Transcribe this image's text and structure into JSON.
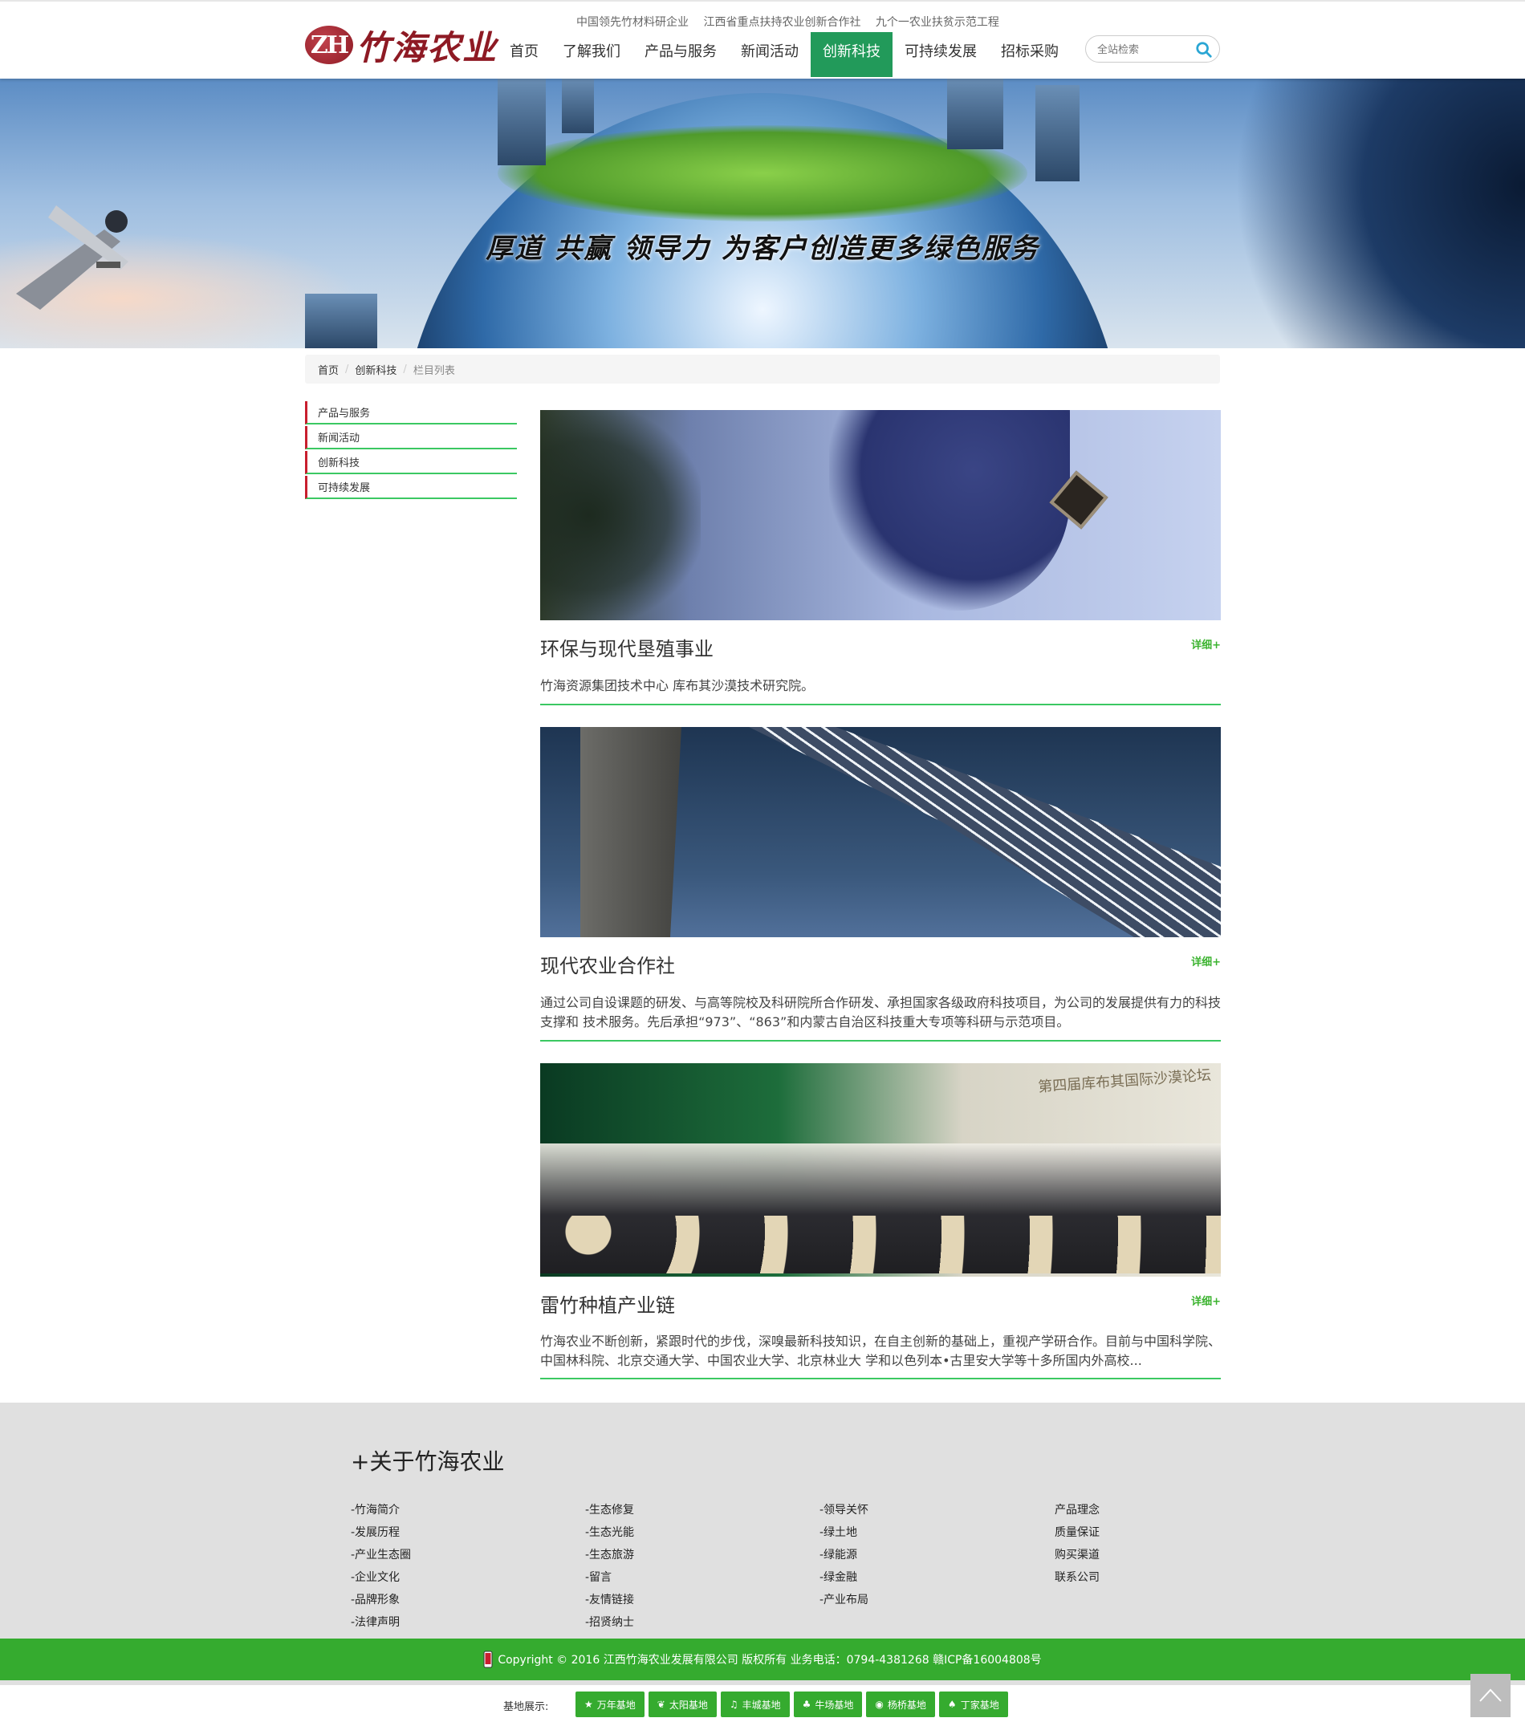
{
  "header": {
    "logo_mark": "ZH",
    "logo_text": "竹海农业",
    "slogans": [
      "中国领先竹材料研企业",
      "江西省重点扶持农业创新合作社",
      "九个一农业扶贫示范工程"
    ],
    "nav": [
      "首页",
      "了解我们",
      "产品与服务",
      "新闻活动",
      "创新科技",
      "可持续发展",
      "招标采购"
    ],
    "nav_active": "创新科技",
    "search_placeholder": "全站检索"
  },
  "banner": {
    "tagline": "厚道 共赢 领导力 为客户创造更多绿色服务"
  },
  "breadcrumb": {
    "items": [
      "首页",
      "创新科技"
    ],
    "current": "栏目列表"
  },
  "sidebar": {
    "items": [
      "产品与服务",
      "新闻活动",
      "创新科技",
      "可持续发展"
    ]
  },
  "articles": [
    {
      "title": "环保与现代垦殖事业",
      "more": "详细+",
      "desc": "竹海资源集团技术中心 库布其沙漠技术研究院。"
    },
    {
      "title": "现代农业合作社",
      "more": "详细+",
      "desc": "通过公司自设课题的研发、与高等院校及科研院所合作研发、承担国家各级政府科技项目，为公司的发展提供有力的科技支撑和 技术服务。先后承担“973”、“863”和内蒙古自治区科技重大专项等科研与示范项目。"
    },
    {
      "title": "雷竹种植产业链",
      "more": "详细+",
      "desc": "竹海农业不断创新，紧跟时代的步伐，深嗅最新科技知识，在自主创新的基础上，重视产学研合作。目前与中国科学院、中国林科院、北京交通大学、中国农业大学、北京林业大 学和以色列本•古里安大学等十多所国内外高校...",
      "image_sign": "第四届库布其国际沙漠论坛"
    }
  ],
  "footer": {
    "title": "+关于竹海农业",
    "columns": [
      [
        "-竹海简介",
        "-发展历程",
        "-产业生态圈",
        "-企业文化",
        "-品牌形象",
        "-法律声明"
      ],
      [
        "-生态修复",
        "-生态光能",
        "-生态旅游",
        "-留言",
        "-友情链接",
        "-招贤纳士"
      ],
      [
        "-领导关怀",
        "-绿土地",
        "-绿能源",
        "-绿金融",
        "-产业布局"
      ],
      [
        "产品理念",
        "质量保证",
        "购买渠道",
        "联系公司"
      ]
    ],
    "copyright": "Copyright © 2016 江西竹海农业发展有限公司 版权所有 业务电话：0794-4381268 赣ICP备16004808号",
    "base_label": "基地展示:",
    "bases": [
      {
        "label": "万年基地",
        "icon": "star-icon"
      },
      {
        "label": "太阳基地",
        "icon": "leaf-icon"
      },
      {
        "label": "丰城基地",
        "icon": "bell-icon"
      },
      {
        "label": "牛场基地",
        "icon": "sprout-icon"
      },
      {
        "label": "杨桥基地",
        "icon": "globe-icon"
      },
      {
        "label": "丁家基地",
        "icon": "tree-icon"
      }
    ]
  },
  "colors": {
    "brand_red": "#8e1a24",
    "nav_active": "#229a5a",
    "accent_green": "#35ab2f",
    "divider_green": "#3bc862",
    "side_marker": "#c81e2e"
  }
}
